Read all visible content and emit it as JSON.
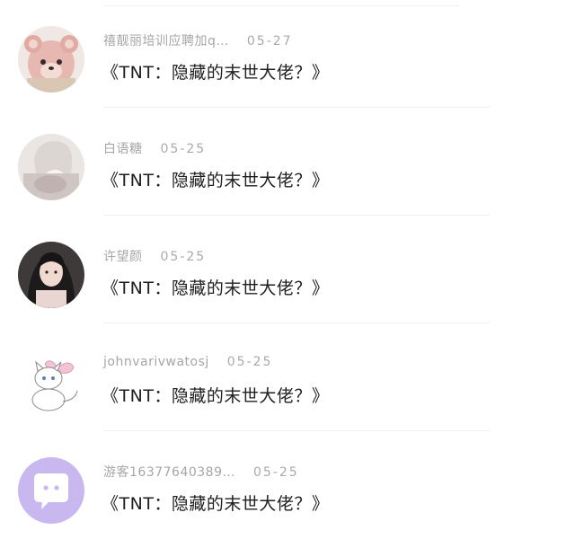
{
  "comments": [
    {
      "username": "禧靓丽培训应聘加q…",
      "date": "05-27",
      "text": "《TNT：隐藏的末世大佬？》",
      "avatar_icon": "teddy-bear-avatar"
    },
    {
      "username": "白语糖",
      "date": "05-25",
      "text": "《TNT：隐藏的末世大佬？》",
      "avatar_icon": "girl-avatar"
    },
    {
      "username": "许望颜",
      "date": "05-25",
      "text": "《TNT：隐藏的末世大佬？》",
      "avatar_icon": "portrait-avatar"
    },
    {
      "username": "johnvarivwatosj",
      "date": "05-25",
      "text": "《TNT：隐藏的末世大佬？》",
      "avatar_icon": "white-cat-avatar"
    },
    {
      "username": "游客16377640389…",
      "date": "05-25",
      "text": "《TNT：隐藏的末世大佬？》",
      "avatar_icon": "chat-bubble-avatar"
    }
  ],
  "colors": {
    "meta_text": "#a6a6a6",
    "comment_text": "#1f1f1f",
    "divider": "#efefef",
    "guest_avatar_bg": "#c9b8f0"
  }
}
